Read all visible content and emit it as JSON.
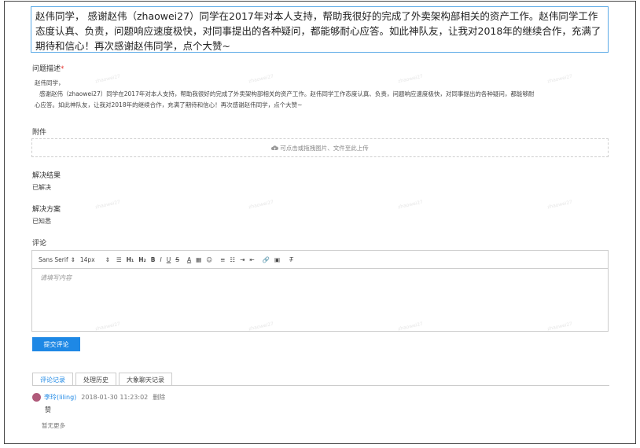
{
  "ticket": {
    "title": "赵伟同学，  感谢赵伟（zhaowei27）同学在2017年对本人支持，帮助我很好的完成了外卖架构部相关的资产工作。赵伟同学工作态度认真、负责，问题响应速度极快，对同事提出的各种疑问，都能够耐心应答。如此神队友，让我对2018年的继续合作，充满了期待和信心！再次感谢赵伟同学，点个大赞~"
  },
  "problem": {
    "label": "问题描述",
    "required_mark": "*",
    "line1": "赵伟同学，",
    "line2": "感谢赵伟（zhaowei27）同学在2017年对本人支持，帮助我很好的完成了外卖架构部相关的资产工作。赵伟同学工作态度认真、负责，问题响应速度极快，对同事提出的各种疑问，都能够耐",
    "line3": "心应答。如此神队友，让我对2018年的继续合作，充满了期待和信心！再次感谢赵伟同学，点个大赞~"
  },
  "attachment": {
    "label": "附件",
    "upload_hint": "可点击或拖拽图片、文件至此上传"
  },
  "result": {
    "label": "解决结果",
    "value": "已解决"
  },
  "solution": {
    "label": "解决方案",
    "value": "已知悉"
  },
  "comment_section": {
    "label": "评论",
    "font": "Sans Serif",
    "size": "14px",
    "placeholder": "请填写内容",
    "submit": "提交评论"
  },
  "tabs": [
    "评论记录",
    "处理历史",
    "大象聊天记录"
  ],
  "comments": [
    {
      "user": "李玲(liling)",
      "time": "2018-01-30 11:23:02",
      "delete": "删除",
      "text": "赞"
    }
  ],
  "no_more": "暂无更多",
  "watermark": "zhaowei27",
  "colors": {
    "accent": "#1e88e5",
    "border_focus": "#5aa9e6",
    "required": "#e53935"
  }
}
